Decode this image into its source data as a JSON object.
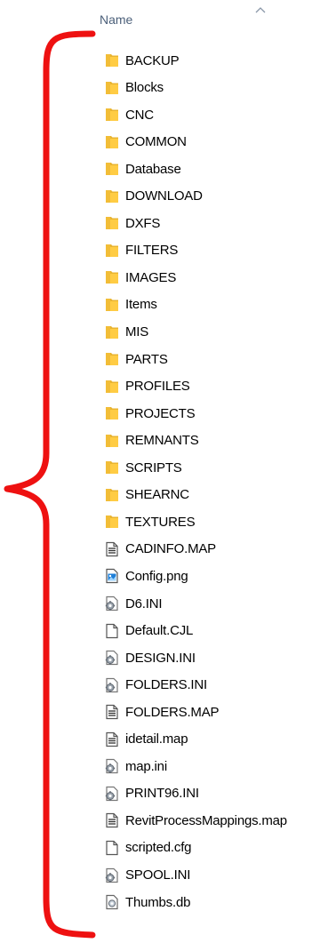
{
  "header": {
    "name_label": "Name",
    "sort": "ascending"
  },
  "annotation": {
    "color": "#ee1111",
    "shape": "curly-brace"
  },
  "colors": {
    "folder": "#ffcc44",
    "folder_dark": "#e9b430",
    "header_text": "#4c607a"
  },
  "items": [
    {
      "label": "BACKUP",
      "icon": "folder-icon"
    },
    {
      "label": "Blocks",
      "icon": "folder-icon"
    },
    {
      "label": "CNC",
      "icon": "folder-icon"
    },
    {
      "label": "COMMON",
      "icon": "folder-icon"
    },
    {
      "label": "Database",
      "icon": "folder-icon"
    },
    {
      "label": "DOWNLOAD",
      "icon": "folder-icon"
    },
    {
      "label": "DXFS",
      "icon": "folder-icon"
    },
    {
      "label": "FILTERS",
      "icon": "folder-icon"
    },
    {
      "label": "IMAGES",
      "icon": "folder-icon"
    },
    {
      "label": "Items",
      "icon": "folder-icon"
    },
    {
      "label": "MIS",
      "icon": "folder-icon"
    },
    {
      "label": "PARTS",
      "icon": "folder-icon"
    },
    {
      "label": "PROFILES",
      "icon": "folder-icon"
    },
    {
      "label": "PROJECTS",
      "icon": "folder-icon"
    },
    {
      "label": "REMNANTS",
      "icon": "folder-icon"
    },
    {
      "label": "SCRIPTS",
      "icon": "folder-icon"
    },
    {
      "label": "SHEARNC",
      "icon": "folder-icon"
    },
    {
      "label": "TEXTURES",
      "icon": "folder-icon"
    },
    {
      "label": "CADINFO.MAP",
      "icon": "text-file-icon"
    },
    {
      "label": "Config.png",
      "icon": "image-file-icon"
    },
    {
      "label": "D6.INI",
      "icon": "config-file-icon"
    },
    {
      "label": "Default.CJL",
      "icon": "blank-file-icon"
    },
    {
      "label": "DESIGN.INI",
      "icon": "config-file-icon"
    },
    {
      "label": "FOLDERS.INI",
      "icon": "config-file-icon"
    },
    {
      "label": "FOLDERS.MAP",
      "icon": "text-file-icon"
    },
    {
      "label": "idetail.map",
      "icon": "text-file-icon"
    },
    {
      "label": "map.ini",
      "icon": "config-file-icon"
    },
    {
      "label": "PRINT96.INI",
      "icon": "config-file-icon"
    },
    {
      "label": "RevitProcessMappings.map",
      "icon": "text-file-icon"
    },
    {
      "label": "scripted.cfg",
      "icon": "blank-file-icon"
    },
    {
      "label": "SPOOL.INI",
      "icon": "config-file-icon"
    },
    {
      "label": "Thumbs.db",
      "icon": "db-file-icon"
    }
  ]
}
